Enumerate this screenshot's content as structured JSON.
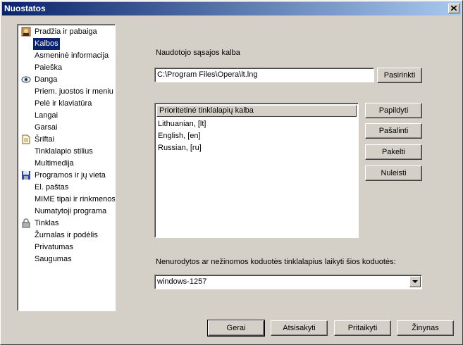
{
  "window": {
    "title": "Nuostatos"
  },
  "tree": {
    "items": [
      {
        "label": "Pradžia ir pabaiga",
        "icon": "user-portrait-icon"
      },
      {
        "label": "Kalbos",
        "selected": true
      },
      {
        "label": "Asmeninė informacija"
      },
      {
        "label": "Paieška"
      },
      {
        "label": "Danga",
        "icon": "eye-icon"
      },
      {
        "label": "Priem. juostos ir meniu"
      },
      {
        "label": "Pelė ir klaviatūra"
      },
      {
        "label": "Langai"
      },
      {
        "label": "Garsai"
      },
      {
        "label": "Šriftai",
        "icon": "document-icon"
      },
      {
        "label": "Tinklalapio stilius"
      },
      {
        "label": "Multimedija"
      },
      {
        "label": "Programos ir jų vieta",
        "icon": "floppy-disk-icon"
      },
      {
        "label": "El. paštas"
      },
      {
        "label": "MIME tipai ir rinkmenos"
      },
      {
        "label": "Numatytoji programa"
      },
      {
        "label": "Tinklas",
        "icon": "padlock-icon"
      },
      {
        "label": "Žurnalas ir podėlis"
      },
      {
        "label": "Privatumas"
      },
      {
        "label": "Saugumas"
      }
    ]
  },
  "ui_language": {
    "label": "Naudotojo sąsajos kalba",
    "path": "C:\\Program Files\\Opera\\lt.lng",
    "choose_label": "Pasirinkti"
  },
  "page_languages": {
    "header": "Prioritetinė tinklalapių kalba",
    "rows": [
      "Lithuanian, [lt]",
      "English, [en]",
      "Russian, [ru]"
    ],
    "add_label": "Papildyti",
    "remove_label": "Pašalinti",
    "up_label": "Pakelti",
    "down_label": "Nuleisti"
  },
  "encoding": {
    "label": "Nenurodytos ar nežinomos koduotės tinklalapius laikyti šios koduotės:",
    "value": "windows-1257"
  },
  "footer": {
    "ok_label": "Gerai",
    "cancel_label": "Atsisakyti",
    "apply_label": "Pritaikyti",
    "help_label": "Žinynas"
  },
  "colors": {
    "selection": "#0a246a",
    "titlebar_start": "#0a246a",
    "titlebar_end": "#a6caf0",
    "face": "#d4d0c8"
  }
}
